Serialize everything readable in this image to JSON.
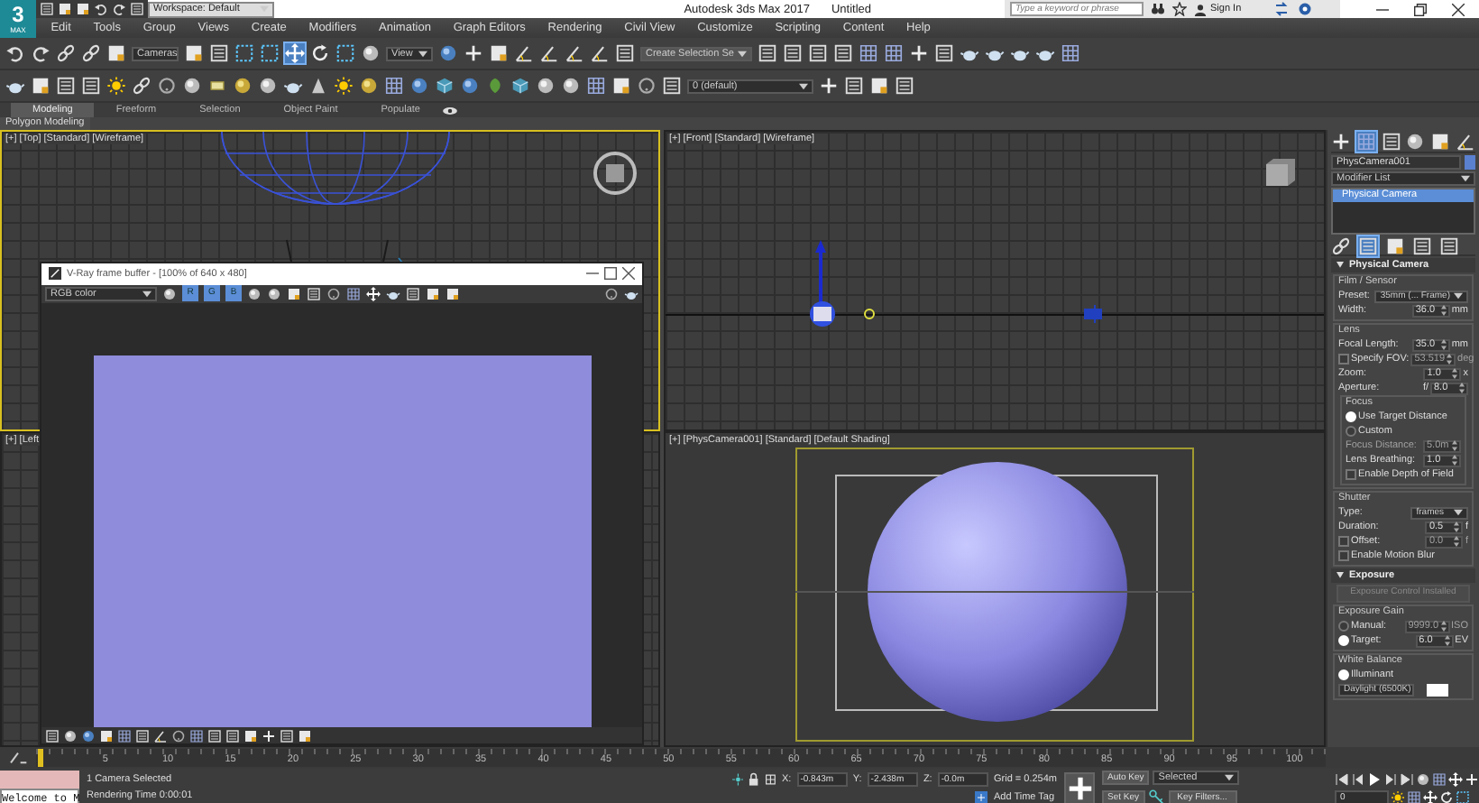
{
  "app": {
    "logo": "3",
    "logo_sub": "MAX",
    "workspace": "Workspace: Default",
    "title": "Autodesk 3ds Max 2017",
    "file": "Untitled",
    "search_placeholder": "Type a keyword or phrase",
    "sign_in": "Sign In"
  },
  "menu": [
    "Edit",
    "Tools",
    "Group",
    "Views",
    "Create",
    "Modifiers",
    "Animation",
    "Graph Editors",
    "Rendering",
    "Civil View",
    "Customize",
    "Scripting",
    "Content",
    "Help"
  ],
  "main_toolbar": {
    "named_set": "Cameras",
    "ref_coord": "View",
    "selection_set": "Create Selection Se"
  },
  "layer_toolbar": {
    "layer": "0 (default)"
  },
  "ribbon": {
    "tabs": [
      {
        "label": "Modeling",
        "selected": true
      },
      {
        "label": "Freeform",
        "selected": false
      },
      {
        "label": "Selection",
        "selected": false
      },
      {
        "label": "Object Paint",
        "selected": false
      },
      {
        "label": "Populate",
        "selected": false
      }
    ],
    "panel": "Polygon Modeling"
  },
  "viewports": [
    {
      "label": "[+] [Top] [Standard] [Wireframe]",
      "kind": "top",
      "active": true
    },
    {
      "label": "[+] [Front] [Standard] [Wireframe]",
      "kind": "front",
      "active": false
    },
    {
      "label": "[+] [Left",
      "kind": "left",
      "active": false
    },
    {
      "label": "[+] [PhysCamera001] [Standard] [Default Shading]",
      "kind": "camera",
      "active": false
    }
  ],
  "frame_buffer": {
    "title": "V-Ray frame buffer - [100% of 640 x 480]",
    "channel": "RGB color",
    "channels": [
      {
        "label": "R",
        "selected": true
      },
      {
        "label": "G",
        "selected": true
      },
      {
        "label": "B",
        "selected": true
      }
    ]
  },
  "command_panel": {
    "object_name": "PhysCamera001",
    "modifier_list": "Modifier List",
    "stack": [
      {
        "label": "Physical Camera",
        "selected": true
      }
    ],
    "rollouts": [
      {
        "title": "Physical Camera",
        "groups": [
          {
            "title": "Film / Sensor",
            "rows": [
              {
                "kind": "dropdown",
                "label": "Preset:",
                "value": "35mm (... Frame)"
              },
              {
                "kind": "spinner",
                "label": "Width:",
                "value": "36.0",
                "unit": "mm",
                "disabled": false
              }
            ]
          },
          {
            "title": "Lens",
            "rows": [
              {
                "kind": "spinner",
                "label": "Focal Length:",
                "value": "35.0",
                "unit": "mm",
                "disabled": false
              },
              {
                "kind": "check-spinner",
                "label": "Specify FOV:",
                "checked": false,
                "value": "53.519",
                "unit": "deg",
                "disabled": true
              },
              {
                "kind": "spinner",
                "label": "Zoom:",
                "value": "1.0",
                "unit": "x",
                "disabled": false
              },
              {
                "kind": "spinner",
                "label": "Aperture:",
                "prefix": "f/",
                "value": "8.0",
                "disabled": false
              }
            ],
            "subgroups": [
              {
                "title": "Focus",
                "rows": [
                  {
                    "kind": "radio",
                    "label": "Use Target Distance",
                    "selected": true
                  },
                  {
                    "kind": "radio",
                    "label": "Custom",
                    "selected": false
                  },
                  {
                    "kind": "spinner",
                    "label": "Focus Distance:",
                    "value": "5.0m",
                    "disabled": true
                  },
                  {
                    "kind": "spinner",
                    "label": "Lens Breathing:",
                    "value": "1.0",
                    "disabled": false
                  },
                  {
                    "kind": "check",
                    "label": "Enable Depth of Field",
                    "checked": false
                  }
                ]
              }
            ]
          },
          {
            "title": "Shutter",
            "rows": [
              {
                "kind": "dropdown",
                "label": "Type:",
                "value": "frames"
              },
              {
                "kind": "spinner",
                "label": "Duration:",
                "value": "0.5",
                "unit": "f",
                "disabled": false
              },
              {
                "kind": "check-spinner",
                "label": "Offset:",
                "checked": false,
                "value": "0.0",
                "unit": "f",
                "disabled": true
              },
              {
                "kind": "check",
                "label": "Enable Motion Blur",
                "checked": false
              }
            ]
          }
        ]
      },
      {
        "title": "Exposure",
        "button": "Exposure Control Installed",
        "groups": [
          {
            "title": "Exposure Gain",
            "rows": [
              {
                "kind": "radio-spinner",
                "label": "Manual:",
                "selected": false,
                "value": "9999.0",
                "unit": "ISO",
                "disabled": true
              },
              {
                "kind": "radio-spinner",
                "label": "Target:",
                "selected": true,
                "value": "6.0",
                "unit": "EV",
                "disabled": false
              }
            ]
          },
          {
            "title": "White Balance",
            "rows": [
              {
                "kind": "radio",
                "label": "Illuminant",
                "selected": true
              },
              {
                "kind": "dropdown-swatch",
                "value": "Daylight (6500K)"
              }
            ]
          }
        ]
      }
    ]
  },
  "timeline": {
    "ticks": [
      "5",
      "10",
      "15",
      "20",
      "25",
      "30",
      "35",
      "40",
      "45",
      "50",
      "55",
      "60",
      "65",
      "70",
      "75",
      "80",
      "85",
      "90",
      "95",
      "100"
    ]
  },
  "status": {
    "listener": "Welcome to M",
    "selection": "1 Camera Selected",
    "render_time": "Rendering Time  0:00:01",
    "x_label": "X:",
    "x": "-0.843m",
    "y_label": "Y:",
    "y": "-2.438m",
    "z_label": "Z:",
    "z": "-0.0m",
    "grid": "Grid = 0.254m",
    "time_tag": "Add Time Tag",
    "auto_key": "Auto Key",
    "key_mode": "Selected",
    "set_key": "Set Key",
    "key_filters": "Key Filters...",
    "frame": "0"
  }
}
